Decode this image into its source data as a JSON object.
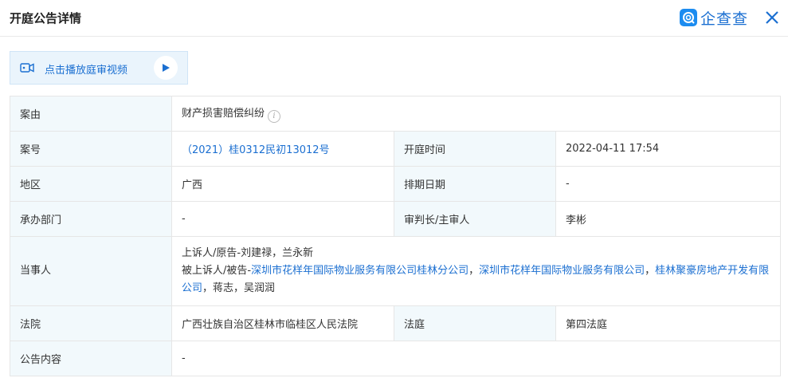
{
  "header": {
    "title": "开庭公告详情",
    "brand": "企查查",
    "brand_color": "#1c8cf0"
  },
  "video_button": {
    "label": "点击播放庭审视频"
  },
  "labels": {
    "case_reason": "案由",
    "case_number": "案号",
    "hearing_time": "开庭时间",
    "region": "地区",
    "schedule_date": "排期日期",
    "department": "承办部门",
    "judge": "审判长/主审人",
    "parties": "当事人",
    "court": "法院",
    "courtroom": "法庭",
    "content": "公告内容"
  },
  "values": {
    "case_reason": "财产损害赔偿纠纷",
    "case_number": "（2021）桂0312民初13012号",
    "hearing_time": "2022-04-11 17:54",
    "region": "广西",
    "schedule_date": "-",
    "department": "-",
    "judge": "李彬",
    "court": "广西壮族自治区桂林市临桂区人民法院",
    "courtroom": "第四法庭",
    "content": "-"
  },
  "parties": {
    "line1": "上诉人/原告-刘建禄，兰永新",
    "line2_prefix": "被上诉人/被告-",
    "company1": "深圳市花样年国际物业服务有限公司桂林分公司",
    "sep1": "，",
    "company2": "深圳市花样年国际物业服务有限公司",
    "sep2": "，",
    "company3": "桂林聚豪房地产开发有限公司",
    "suffix": "，蒋志，吴润润"
  }
}
